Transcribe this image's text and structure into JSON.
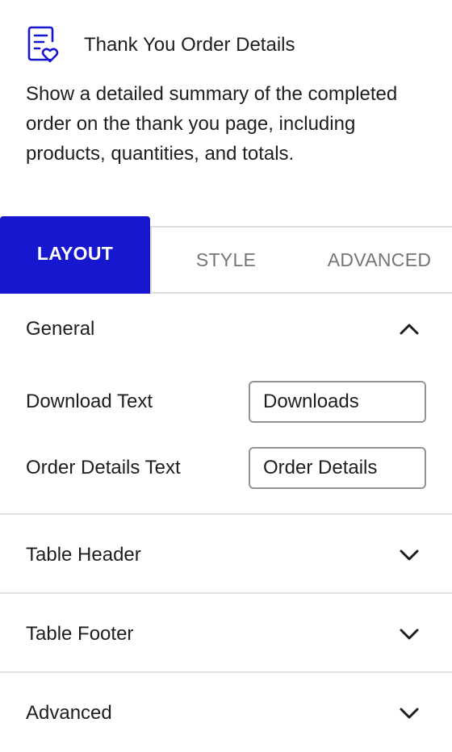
{
  "block": {
    "icon": "document-heart-icon",
    "title": "Thank You Order Details",
    "description": "Show a detailed summary of the completed order on the thank you page, including products, quantities, and totals."
  },
  "tabs": {
    "layout": "LAYOUT",
    "style": "STYLE",
    "advanced": "ADVANCED",
    "active": "layout"
  },
  "sections": {
    "general": {
      "title": "General",
      "expanded": true,
      "fields": {
        "download_text": {
          "label": "Download Text",
          "value": "Downloads"
        },
        "order_details_text": {
          "label": "Order Details Text",
          "value": "Order Details"
        }
      }
    },
    "table_header": {
      "title": "Table Header",
      "expanded": false
    },
    "table_footer": {
      "title": "Table Footer",
      "expanded": false
    },
    "advanced": {
      "title": "Advanced",
      "expanded": false
    }
  },
  "colors": {
    "accent": "#1717cf",
    "text": "#1e1e1e",
    "muted": "#757575",
    "border": "#dcdcdc"
  }
}
